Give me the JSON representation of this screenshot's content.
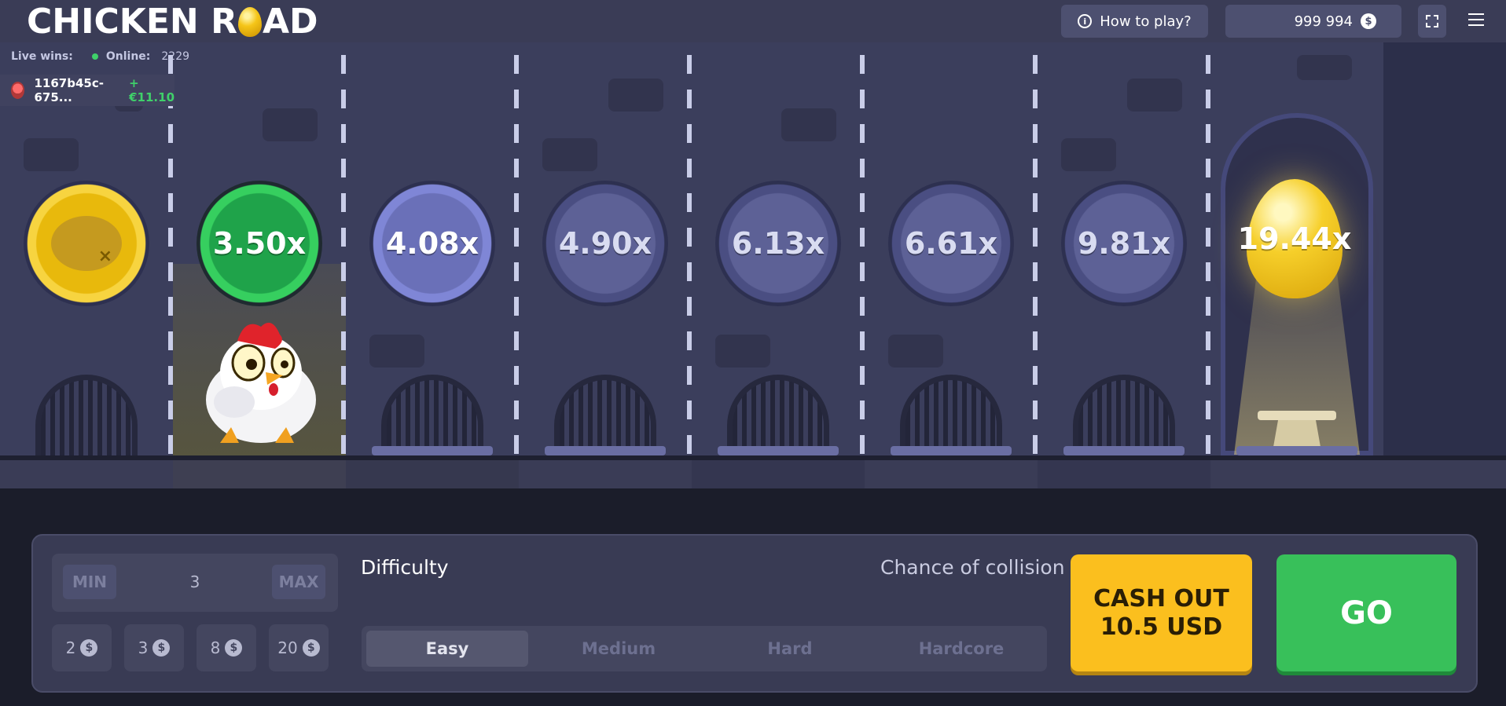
{
  "header": {
    "logo_part1": "CHICKEN R",
    "logo_part2": "AD",
    "how_to_play": "How to play?",
    "balance": "999 994",
    "currency_symbol": "$"
  },
  "live": {
    "label": "Live wins:",
    "online_label": "Online:",
    "online_count": "2229",
    "win_user": "1167b45c-675...",
    "win_amount": "+€11.10"
  },
  "lanes": [
    {
      "multiplier": "3.50x",
      "state": "passed"
    },
    {
      "multiplier": "4.08x",
      "state": "next"
    },
    {
      "multiplier": "4.90x",
      "state": "locked"
    },
    {
      "multiplier": "6.13x",
      "state": "locked"
    },
    {
      "multiplier": "6.61x",
      "state": "locked"
    },
    {
      "multiplier": "9.81x",
      "state": "locked"
    }
  ],
  "finish": {
    "multiplier": "19.44x"
  },
  "controls": {
    "min_label": "MIN",
    "max_label": "MAX",
    "bet_value": "3",
    "chips": [
      "2",
      "3",
      "8",
      "20"
    ],
    "difficulty_title": "Difficulty",
    "chance_title": "Chance of collision",
    "difficulties": [
      "Easy",
      "Medium",
      "Hard",
      "Hardcore"
    ],
    "active_difficulty": "Easy",
    "cashout_line1": "CASH OUT",
    "cashout_line2": "10.5 USD",
    "go_label": "GO"
  },
  "colors": {
    "accent_yellow": "#fbbf1e",
    "accent_green": "#38c05a",
    "background": "#3b3e5c"
  }
}
